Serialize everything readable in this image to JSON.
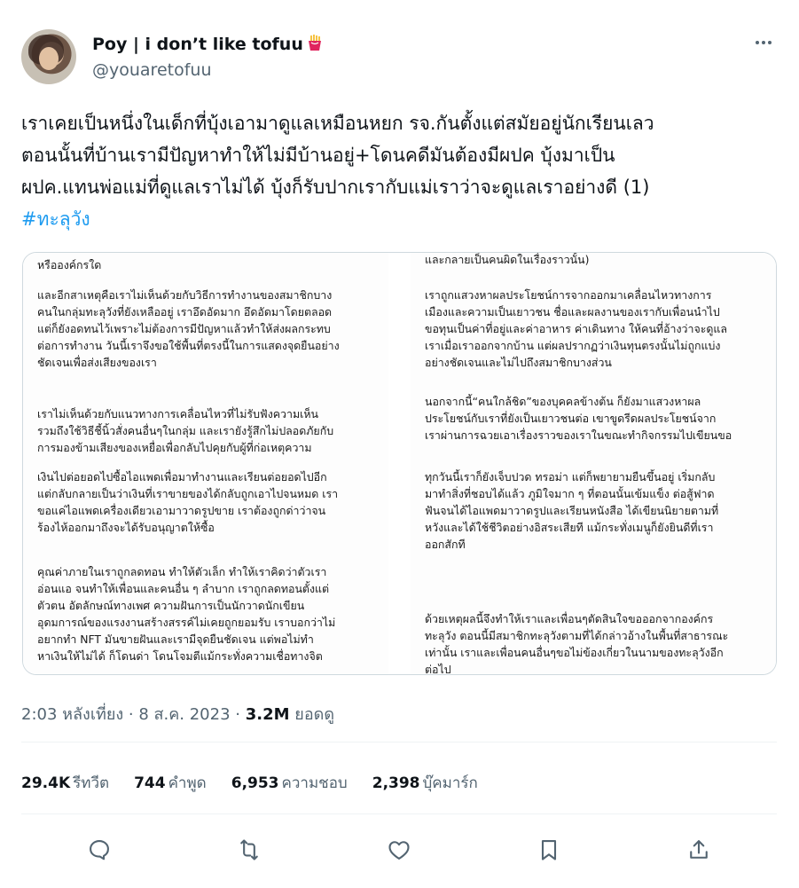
{
  "author": {
    "name": "Poy | i don’t like tofuu",
    "handle": "@youaretofuu",
    "avatar_icon": "profile-photo",
    "name_emoji_icon": "french-fries-icon"
  },
  "more_icon": "more-horizontal-icon",
  "tweet": {
    "lines": [
      "เราเคยเป็นหนึ่งในเด็กที่บุ้งเอามาดูแลเหมือนหยก รจ.กันตั้งแต่สมัยอยู่นักเรียนเลว",
      "ตอนนั้นที่บ้านเรามีปัญหาทำให้ไม่มีบ้านอยู่+โดนคดีมันต้องมีผปค บุ้งมาเป็น",
      "ผปค.แทนพ่อแม่ที่ดูแลเราไม่ได้ บุ้งก็รับปากเรากับแม่เราว่าจะดูแลเราอย่างดี (1)"
    ],
    "hashtag": "#ทะลุวัง"
  },
  "media": {
    "left_col": [
      {
        "lines": [
          "หรือองค์กรใด"
        ]
      },
      {
        "lines": [
          "และอีกสาเหตุคือเราไม่เห็นด้วยกับวิธีการทำงานของสมาชิกบาง",
          "คนในกลุ่มทะลุวังที่ยังเหลืออยู่ เราอึดอัดมาก อึดอัดมาโดยตลอด",
          "แต่ก็ยังอดทนไว้เพราะไม่ต้องการมีปัญหาแล้วทำให้ส่งผลกระทบ",
          "ต่อการทำงาน วันนี้เราจึงขอใช้พื้นที่ตรงนี้ในการแสดงจุดยืนอย่าง",
          "ชัดเจนเพื่อส่งเสียงของเรา"
        ]
      },
      {
        "lines": [
          "เราไม่เห็นด้วยกับแนวทางการเคลื่อนไหวที่ไม่รับฟังความเห็น",
          "รวมถึงใช้วิธีชี้นิ้วสั่งคนอื่นๆในกลุ่ม และเรายังรู้สึกไม่ปลอดภัยกับ",
          "การมองข้ามเสียงของเหยื่อเพื่อกลับไปคุยกับผู้ที่ก่อเหตุความ"
        ]
      },
      {
        "lines": [
          "เงินไปต่อยอดไปซื้อไอแพดเพื่อมาทำงานและเรียนต่อยอดไปอีก",
          "แต่กลับกลายเป็นว่าเงินที่เราขายของได้กลับถูกเอาไปจนหมด เรา",
          "ขอแค่ไอแพดเครื่องเดียวเอามาวาดรูปขาย เราต้องถูกด่าว่าจน",
          "ร้องไห้ออกมาถึงจะได้รับอนุญาตให้ซื้อ"
        ]
      },
      {
        "lines": [
          "คุณค่าภายในเราถูกลดทอน ทำให้ตัวเล็ก ทำให้เราคิดว่าตัวเรา",
          "อ่อนแอ จนทำให้เพื่อนและคนอื่น ๆ ลำบาก เราถูกลดทอนตั้งแต่",
          "ตัวตน อัตลักษณ์ทางเพศ ความฝันการเป็นนักวาดนักเขียน",
          "อุดมการณ์ของแรงงานสร้างสรรค์ไม่เคยถูกยอมรับ เราบอกว่าไม่",
          "อยากทำ NFT มันขายฝันและเรามีจุดยืนชัดเจน แต่พอไม่ทำ",
          "หาเงินให้ไม่ได้ ก็โดนด่า โดนโจมตีแม้กระทั่งความเชื่อทางจิต"
        ]
      }
    ],
    "right_col": [
      {
        "lines": [
          "และกลายเป็นคนผิดในเรื่องราวนั้น)"
        ]
      },
      {
        "lines": [
          "เราถูกแสวงหาผลประโยชน์การจากออกมาเคลื่อนไหวทางการ",
          "เมืองและความเป็นเยาวชน ชื่อและผลงานของเรากับเพื่อนนำไป",
          "ขอทุนเป็นค่าที่อยู่และค่าอาหาร ค่าเดินทาง ให้คนที่อ้างว่าจะดูแล",
          "เราเมื่อเราออกจากบ้าน แต่ผลปรากฏว่าเงินทุนตรงนั้นไม่ถูกแบ่ง",
          "อย่างชัดเจนและไม่ไปถึงสมาชิกบางส่วน"
        ]
      },
      {
        "lines": [
          "นอกจากนี้“คนใกล้ชิด”ของบุคคลข้างต้น ก็ยังมาแสวงหาผล",
          "ประโยชน์กับเราที่ยังเป็นเยาวชนต่อ เขาขูดรีดผลประโยชน์จาก",
          "เราผ่านการฉวยเอาเรื่องราวของเราในขณะทำกิจกรรมไปเขียนขอ"
        ]
      },
      {
        "lines": [
          "ทุกวันนี้เราก็ยังเจ็บปวด ทรอม่า แต่ก็พยายามยืนขึ้นอยู่ เริ่มกลับ",
          "มาทำสิ่งที่ชอบได้แล้ว ภูมิใจมาก ๆ ที่ตอนนั้นเข้มแข็ง ต่อสู้ฟาด",
          "ฟันจนได้ไอแพดมาวาดรูปและเรียนหนังสือ ได้เขียนนิยายตามที่",
          "หวังและได้ใช้ชีวิตอย่างอิสระเสียที แม้กระทั่งเมนูก็ยังยินดีที่เรา",
          "ออกสักที"
        ]
      },
      {
        "lines": [
          "ด้วยเหตุผลนี้จึงทำให้เราและเพื่อนๆตัดสินใจขอออกจากองค์กร",
          "ทะลุวัง ตอนนี้มีสมาชิกทะลุวังตามที่ได้กล่าวอ้างในพื้นที่สาธารณะ",
          "เท่านั้น เราและเพื่อนคนอื่นๆขอไม่ข้องเกี่ยวในนามของทะลุวังอีก",
          "ต่อไป"
        ]
      }
    ]
  },
  "meta": {
    "time": "2:03 หลังเที่ยง",
    "sep": " · ",
    "date": "8 ส.ค. 2023",
    "views": "3.2M",
    "views_label": "ยอดดู"
  },
  "stats": [
    {
      "num": "29.4K",
      "label": "รีทวีต"
    },
    {
      "num": "744",
      "label": "คำพูด"
    },
    {
      "num": "6,953",
      "label": "ความชอบ"
    },
    {
      "num": "2,398",
      "label": "บุ๊คมาร์ก"
    }
  ],
  "actions": [
    "reply-icon",
    "retweet-icon",
    "like-icon",
    "bookmark-icon",
    "share-icon"
  ],
  "colors": {
    "link": "#1d9bf0",
    "secondary_text": "#536471",
    "primary_text": "#0f1419",
    "border": "#cfd9de"
  }
}
